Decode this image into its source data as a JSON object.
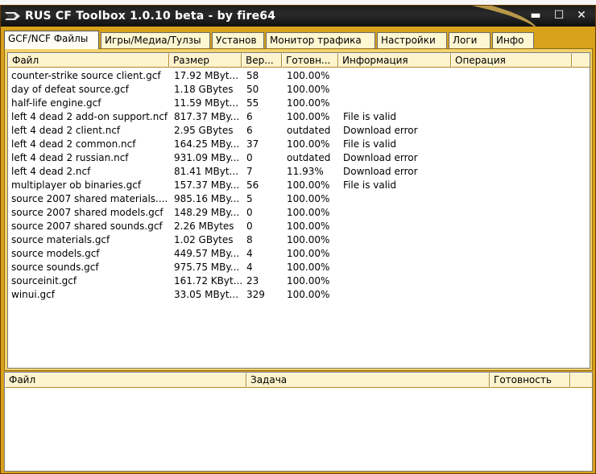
{
  "window": {
    "title": "RUS CF Toolbox 1.0.10 beta - by fire64",
    "min_glyph": "▬",
    "max_glyph": "☐",
    "close_glyph": "✕",
    "icon": "steam-logo-icon"
  },
  "tabs": [
    {
      "label": "GCF/NCF Файлы",
      "active": true
    },
    {
      "label": "Игры/Медиа/Тулзы",
      "active": false
    },
    {
      "label": "Установ",
      "active": false
    },
    {
      "label": "Монитор трафика",
      "active": false
    },
    {
      "label": "Настройки",
      "active": false
    },
    {
      "label": "Логи",
      "active": false
    },
    {
      "label": "Инфо",
      "active": false
    }
  ],
  "file_table": {
    "columns": [
      "Файл",
      "Размер",
      "Вер...",
      "Готовн...",
      "Информация",
      "Операция"
    ],
    "rows": [
      {
        "file": "counter-strike source client.gcf",
        "size": "17.92 MByt...",
        "ver": "58",
        "ready": "100.00%",
        "info": "",
        "op": ""
      },
      {
        "file": "day of defeat source.gcf",
        "size": "1.18 GBytes",
        "ver": "50",
        "ready": "100.00%",
        "info": "",
        "op": ""
      },
      {
        "file": "half-life engine.gcf",
        "size": "11.59 MByt...",
        "ver": "55",
        "ready": "100.00%",
        "info": "",
        "op": ""
      },
      {
        "file": "left 4 dead 2 add-on support.ncf",
        "size": "817.37 MBy...",
        "ver": "6",
        "ready": "100.00%",
        "info": "File is valid",
        "op": ""
      },
      {
        "file": "left 4 dead 2 client.ncf",
        "size": "2.95 GBytes",
        "ver": "6",
        "ready": "outdated",
        "info": "Download error",
        "op": ""
      },
      {
        "file": "left 4 dead 2 common.ncf",
        "size": "164.25 MBy...",
        "ver": "37",
        "ready": "100.00%",
        "info": "File is valid",
        "op": ""
      },
      {
        "file": "left 4 dead 2 russian.ncf",
        "size": "931.09 MBy...",
        "ver": "0",
        "ready": "outdated",
        "info": "Download error",
        "op": ""
      },
      {
        "file": "left 4 dead 2.ncf",
        "size": "81.41 MByt...",
        "ver": "7",
        "ready": "11.93%",
        "info": "Download error",
        "op": ""
      },
      {
        "file": "multiplayer ob binaries.gcf",
        "size": "157.37 MBy...",
        "ver": "56",
        "ready": "100.00%",
        "info": "File is valid",
        "op": ""
      },
      {
        "file": "source 2007 shared materials....",
        "size": "985.16 MBy...",
        "ver": "5",
        "ready": "100.00%",
        "info": "",
        "op": ""
      },
      {
        "file": "source 2007 shared models.gcf",
        "size": "148.29 MBy...",
        "ver": "0",
        "ready": "100.00%",
        "info": "",
        "op": ""
      },
      {
        "file": "source 2007 shared sounds.gcf",
        "size": "2.26 MBytes",
        "ver": "0",
        "ready": "100.00%",
        "info": "",
        "op": ""
      },
      {
        "file": "source materials.gcf",
        "size": "1.02 GBytes",
        "ver": "8",
        "ready": "100.00%",
        "info": "",
        "op": ""
      },
      {
        "file": "source models.gcf",
        "size": "449.57 MBy...",
        "ver": "4",
        "ready": "100.00%",
        "info": "",
        "op": ""
      },
      {
        "file": "source sounds.gcf",
        "size": "975.75 MBy...",
        "ver": "4",
        "ready": "100.00%",
        "info": "",
        "op": ""
      },
      {
        "file": "sourceinit.gcf",
        "size": "161.72 KByt...",
        "ver": "23",
        "ready": "100.00%",
        "info": "",
        "op": ""
      },
      {
        "file": "winui.gcf",
        "size": "33.05 MByt...",
        "ver": "329",
        "ready": "100.00%",
        "info": "",
        "op": ""
      }
    ]
  },
  "task_table": {
    "columns": [
      "Файл",
      "Задача",
      "Готовность"
    ]
  },
  "colors": {
    "frame": "#d9a21b",
    "panel": "#f3d269",
    "header": "#fdf3cc",
    "titlebar": "#1d1d1d"
  }
}
